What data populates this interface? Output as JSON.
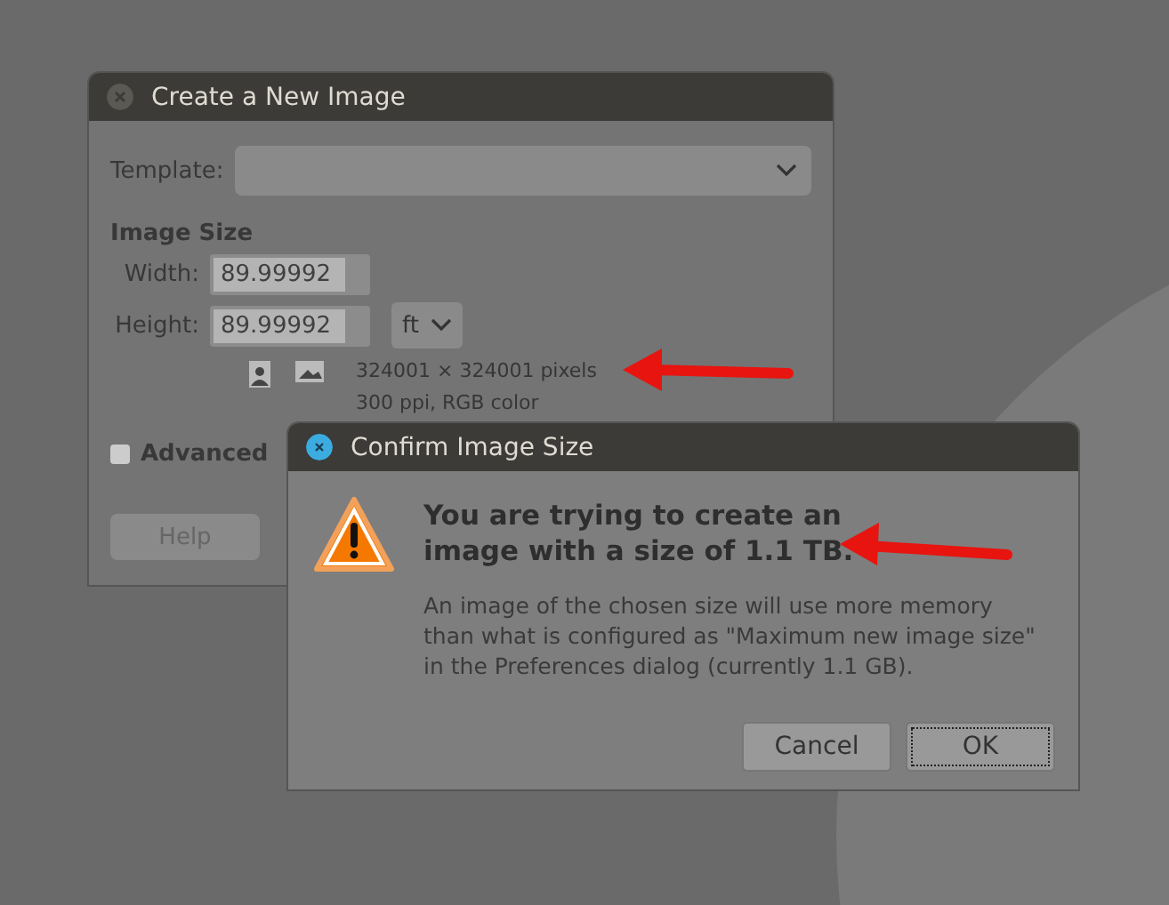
{
  "new_image_window": {
    "title": "Create a New Image",
    "inactive": true,
    "template_label": "Template:",
    "section_title": "Image Size",
    "width_label": "Width:",
    "width_value": "89.99992",
    "height_label": "Height:",
    "height_value": "89.99992",
    "unit": "ft",
    "pixels": "324001 × 324001 pixels",
    "resolution": "300 ppi, RGB color",
    "advanced_label": "Advanced",
    "expanded": false,
    "buttons": [
      "Help"
    ]
  },
  "confirm_dialog": {
    "title": "Confirm Image Size",
    "heading": "You are trying to create an image with a size of 1.1 TB.",
    "message": "An image of the chosen size will use more memory than what is configured as \"Maximum new image size\" in the Preferences dialog (currently 1.1 GB).",
    "buttons": [
      {
        "label": "Cancel",
        "focused": false
      },
      {
        "label": "OK",
        "focused": true
      }
    ]
  }
}
